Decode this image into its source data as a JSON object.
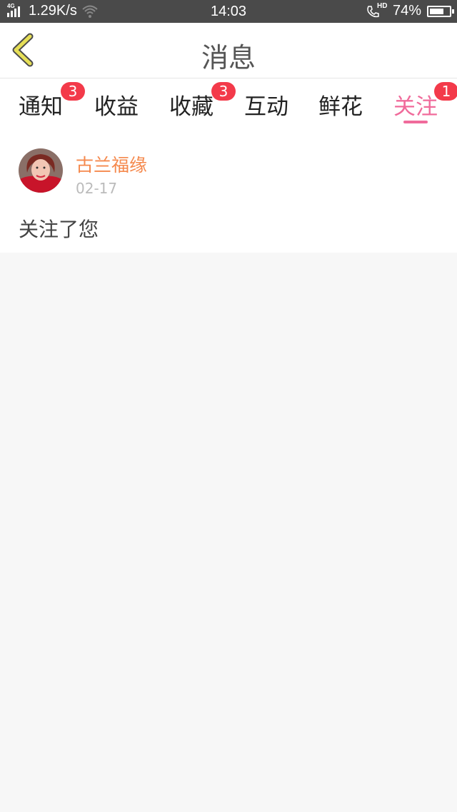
{
  "status_bar": {
    "network": "4G",
    "speed": "1.29K/s",
    "time": "14:03",
    "hd_label": "HD",
    "battery": "74%",
    "battery_level": 0.74
  },
  "header": {
    "back_icon": "chevron-left-icon",
    "title": "消息"
  },
  "tabs": [
    {
      "label": "通知",
      "badge": "3"
    },
    {
      "label": "收益",
      "badge": ""
    },
    {
      "label": "收藏",
      "badge": "3"
    },
    {
      "label": "互动",
      "badge": ""
    },
    {
      "label": "鲜花",
      "badge": ""
    },
    {
      "label": "关注",
      "badge": "1",
      "active": true
    }
  ],
  "feed": [
    {
      "username": "古兰福缘",
      "date": "02-17",
      "message": "关注了您"
    }
  ],
  "colors": {
    "accent": "#f06b9b",
    "badge": "#f33a4a",
    "username": "#f5894d",
    "status_bar": "#4a4a4a",
    "back_icon": "#e6df57"
  }
}
